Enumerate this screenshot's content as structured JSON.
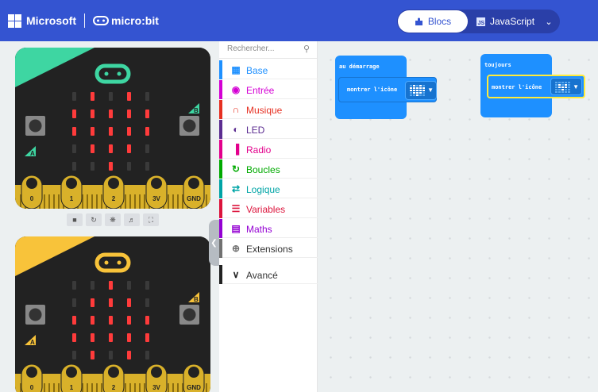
{
  "header": {
    "brand": "Microsoft",
    "product": "micro:bit",
    "tabs": {
      "blocks": "Blocs",
      "javascript": "JavaScript"
    },
    "colors": {
      "bar": "#3454d1",
      "toggle": "#2a3fa8"
    }
  },
  "simulator": {
    "pins": [
      "0",
      "1",
      "2",
      "3V",
      "GND"
    ],
    "buttons": {
      "a": "A",
      "b": "B"
    },
    "led_pattern_top": [
      [
        0,
        1,
        0,
        1,
        0
      ],
      [
        1,
        1,
        1,
        1,
        1
      ],
      [
        1,
        1,
        1,
        1,
        1
      ],
      [
        0,
        1,
        1,
        1,
        0
      ],
      [
        0,
        0,
        1,
        0,
        0
      ]
    ],
    "led_pattern_bottom": [
      [
        0,
        0,
        1,
        0,
        0
      ],
      [
        0,
        1,
        1,
        1,
        0
      ],
      [
        1,
        1,
        1,
        1,
        1
      ],
      [
        1,
        1,
        1,
        1,
        1
      ],
      [
        0,
        1,
        0,
        1,
        0
      ]
    ],
    "toolbar_icons": [
      "stop-icon",
      "restart-icon",
      "debug-icon",
      "sound-icon",
      "fullscreen-icon"
    ],
    "colors": {
      "board_top_accent": "#3ed6a2",
      "board_bottom_accent": "#f8c33a",
      "led_on": "#ff3b3b",
      "pin_gold": "#d9b12a"
    }
  },
  "toolbox": {
    "search_placeholder": "Rechercher...",
    "categories": [
      {
        "label": "Base",
        "color": "#1e90ff",
        "icon": "grid-icon"
      },
      {
        "label": "Entrée",
        "color": "#d400d4",
        "icon": "input-icon"
      },
      {
        "label": "Musique",
        "color": "#e63022",
        "icon": "headphones-icon"
      },
      {
        "label": "LED",
        "color": "#5c2d91",
        "icon": "toggle-icon"
      },
      {
        "label": "Radio",
        "color": "#e3008c",
        "icon": "signal-icon"
      },
      {
        "label": "Boucles",
        "color": "#00aa00",
        "icon": "loop-icon"
      },
      {
        "label": "Logique",
        "color": "#00a4a6",
        "icon": "shuffle-icon"
      },
      {
        "label": "Variables",
        "color": "#dc143c",
        "icon": "list-icon"
      },
      {
        "label": "Maths",
        "color": "#9400d3",
        "icon": "calculator-icon"
      },
      {
        "label": "Extensions",
        "color": "#717171",
        "icon": "plus-icon"
      },
      {
        "label": "Avancé",
        "color": "#222222",
        "icon": "chevron-down-icon"
      }
    ]
  },
  "workspace": {
    "blocks": [
      {
        "title": "au démarrage",
        "statement": "montrer l'icône",
        "icon": "heart"
      },
      {
        "title": "toujours",
        "statement": "montrer l'icône",
        "icon": "small-heart"
      }
    ],
    "colors": {
      "block": "#1e90ff",
      "selected_outline": "#ffeb3b"
    }
  }
}
